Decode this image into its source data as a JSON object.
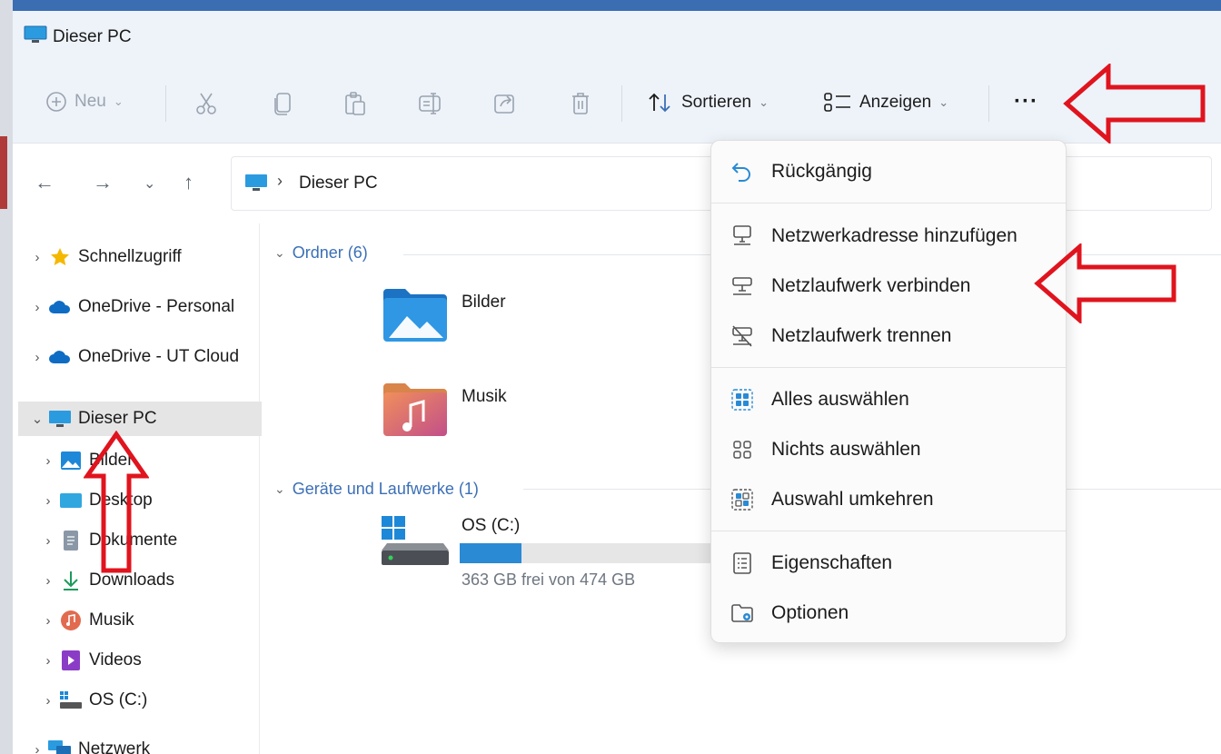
{
  "window": {
    "title": "Dieser PC"
  },
  "toolbar": {
    "new_label": "Neu",
    "sort_label": "Sortieren",
    "view_label": "Anzeigen",
    "more_label": "···"
  },
  "address": {
    "crumb": "Dieser PC"
  },
  "sidebar": {
    "items": [
      {
        "label": "Schnellzugriff",
        "icon": "star-icon"
      },
      {
        "label": "OneDrive - Personal",
        "icon": "cloud-icon"
      },
      {
        "label": "OneDrive - UT Cloud",
        "icon": "cloud-icon"
      },
      {
        "label": "Dieser PC",
        "icon": "monitor-icon"
      },
      {
        "label": "Bilder",
        "icon": "pictures-icon"
      },
      {
        "label": "Desktop",
        "icon": "desktop-icon"
      },
      {
        "label": "Dokumente",
        "icon": "documents-icon"
      },
      {
        "label": "Downloads",
        "icon": "download-icon"
      },
      {
        "label": "Musik",
        "icon": "music-icon"
      },
      {
        "label": "Videos",
        "icon": "video-icon"
      },
      {
        "label": "OS (C:)",
        "icon": "drive-icon"
      },
      {
        "label": "Netzwerk",
        "icon": "network-icon"
      }
    ]
  },
  "content": {
    "folders_group": "Ordner (6)",
    "folders": [
      {
        "name": "Bilder",
        "icon": "pictures-folder-icon"
      },
      {
        "name": "Musik",
        "icon": "music-folder-icon"
      }
    ],
    "drives_group": "Geräte und Laufwerke (1)",
    "drive": {
      "name": "OS (C:)",
      "free_text": "363 GB frei von 474 GB",
      "used_fraction": 0.234
    }
  },
  "menu": {
    "items": [
      {
        "label": "Rückgängig",
        "icon": "undo-icon"
      },
      {
        "label": "Netzwerkadresse hinzufügen",
        "icon": "network-location-icon"
      },
      {
        "label": "Netzlaufwerk verbinden",
        "icon": "map-drive-icon"
      },
      {
        "label": "Netzlaufwerk trennen",
        "icon": "disconnect-drive-icon"
      },
      {
        "label": "Alles auswählen",
        "icon": "select-all-icon"
      },
      {
        "label": "Nichts auswählen",
        "icon": "select-none-icon"
      },
      {
        "label": "Auswahl umkehren",
        "icon": "invert-selection-icon"
      },
      {
        "label": "Eigenschaften",
        "icon": "properties-icon"
      },
      {
        "label": "Optionen",
        "icon": "options-icon"
      }
    ]
  },
  "colors": {
    "accent": "#2a8ad4",
    "annotation": "#e0141e",
    "group_header": "#3b6fb6"
  }
}
